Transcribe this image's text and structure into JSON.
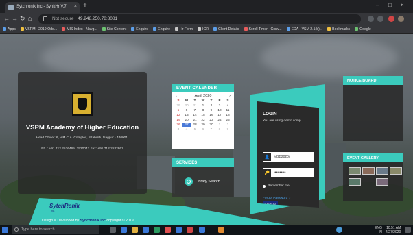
{
  "browser": {
    "tab_title": "Sytchronik Inc - SynkHr V.7",
    "new_tab_symbol": "+",
    "tab_close_symbol": "×",
    "minimize_symbol": "–",
    "maximize_symbol": "□",
    "close_symbol": "×",
    "back_symbol": "←",
    "forward_symbol": "→",
    "reload_symbol": "↻",
    "home_symbol": "⌂",
    "security_label": "Not secure",
    "url": "49.248.250.78:8081",
    "bookmarks": [
      {
        "label": "Apps"
      },
      {
        "label": "VSPM - 2019 Odd..."
      },
      {
        "label": "MIS Index - Navg..."
      },
      {
        "label": "Site Content"
      },
      {
        "label": "Enquire"
      },
      {
        "label": "Enquire"
      },
      {
        "label": "Hr Form"
      },
      {
        "label": "ICR"
      },
      {
        "label": "Client Details"
      },
      {
        "label": "Scroll Timer - Conv..."
      },
      {
        "label": "EDA - VSM 2.1(b)..."
      },
      {
        "label": "Bookmarks"
      },
      {
        "label": "Google"
      }
    ],
    "bookmark_colors": [
      "#5c9ee8",
      "#f0c040",
      "#e85c5c",
      "#6cc070",
      "#5c9ee8",
      "#5c9ee8",
      "#c8c8c8",
      "#c8c8c8",
      "#5c9ee8",
      "#e85c5c",
      "#5c9ee8",
      "#f0c040",
      "#6cc070"
    ]
  },
  "org": {
    "name": "VSPM Academy of Higher Education",
    "address": "Head Office : 6, V.M.C.A. Complex, Sitabuldi, Nagpur - 440001.",
    "phone": "Ph. : +91 712 2536465, 2520047 Fax: +91 712 2532867"
  },
  "calendar": {
    "heading": "EVENT CALENDER",
    "month": "April 2020",
    "prev": "‹",
    "next": "›",
    "weekdays": [
      "S",
      "M",
      "T",
      "W",
      "T",
      "F",
      "S"
    ],
    "weeks": [
      [
        "29",
        "30",
        "31",
        "1",
        "2",
        "3",
        "4"
      ],
      [
        "5",
        "6",
        "7",
        "8",
        "9",
        "10",
        "11"
      ],
      [
        "12",
        "13",
        "14",
        "15",
        "16",
        "17",
        "18"
      ],
      [
        "19",
        "20",
        "21",
        "22",
        "23",
        "24",
        "25"
      ],
      [
        "26",
        "27",
        "28",
        "29",
        "30",
        "1",
        "2"
      ],
      [
        "3",
        "4",
        "5",
        "6",
        "7",
        "8",
        "9"
      ]
    ],
    "today": "27"
  },
  "services": {
    "heading": "SERVICES",
    "item": "Library Search"
  },
  "login": {
    "heading": "LOGIN",
    "hint": "You are using demo comp",
    "username": "MBB2020/",
    "password": "••••••••••",
    "user_icon": "👤",
    "key_icon": "🔑",
    "remember": "Remember me",
    "forgot": "Forgot Password ?",
    "button": "LOG IN"
  },
  "notice": {
    "heading": "NOTICE BOARD"
  },
  "gallery": {
    "heading": "EVENT GALLERY"
  },
  "footer": {
    "brand": "SytchRonik",
    "brand_sub": "Inc.",
    "copyright_prefix": "Design & Developed by",
    "company": "Synchronik Inc",
    "copyright_suffix": "copyright © 2019"
  },
  "taskbar": {
    "search_placeholder": "Type here to search",
    "lang": "ENG",
    "region": "IN",
    "time": "10:51 AM",
    "date": "4/27/2020"
  },
  "colors": {
    "accent": "#3bcbbd",
    "brand_blue": "#1b2a80"
  }
}
